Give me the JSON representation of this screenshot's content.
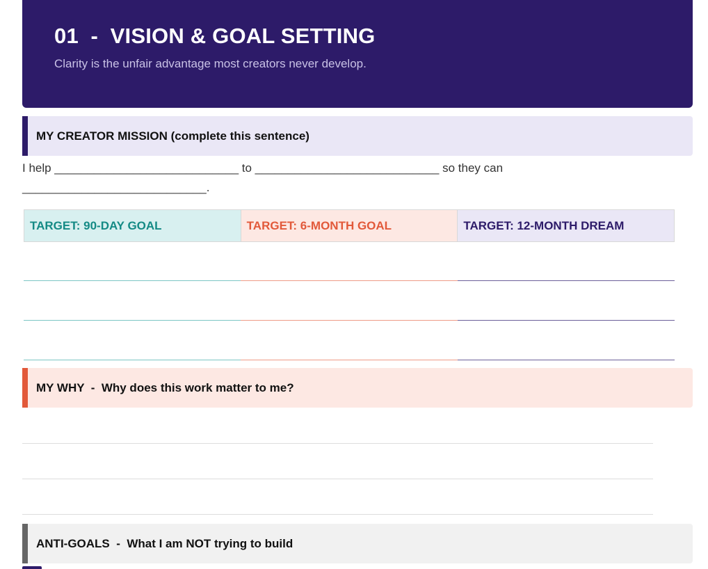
{
  "header": {
    "title": "01  -  VISION & GOAL SETTING",
    "subtitle": "Clarity is the unfair advantage most creators never develop."
  },
  "mission": {
    "heading": "MY CREATOR MISSION (complete this sentence)",
    "line1": "I help ____________________________ to ____________________________ so they can",
    "line2": "____________________________."
  },
  "targets": {
    "goal_90_day": "TARGET: 90-DAY GOAL",
    "goal_6_month": "TARGET: 6-MONTH GOAL",
    "dream_12_month": "TARGET: 12-MONTH DREAM"
  },
  "why": {
    "heading": "MY WHY  -  Why does this work matter to me?"
  },
  "anti_goals": {
    "heading": "ANTI-GOALS  -  What I am NOT trying to build"
  },
  "colors": {
    "brand": "#2d1b69",
    "teal": "#148a85",
    "coral": "#e2593a",
    "gray": "#666666"
  }
}
